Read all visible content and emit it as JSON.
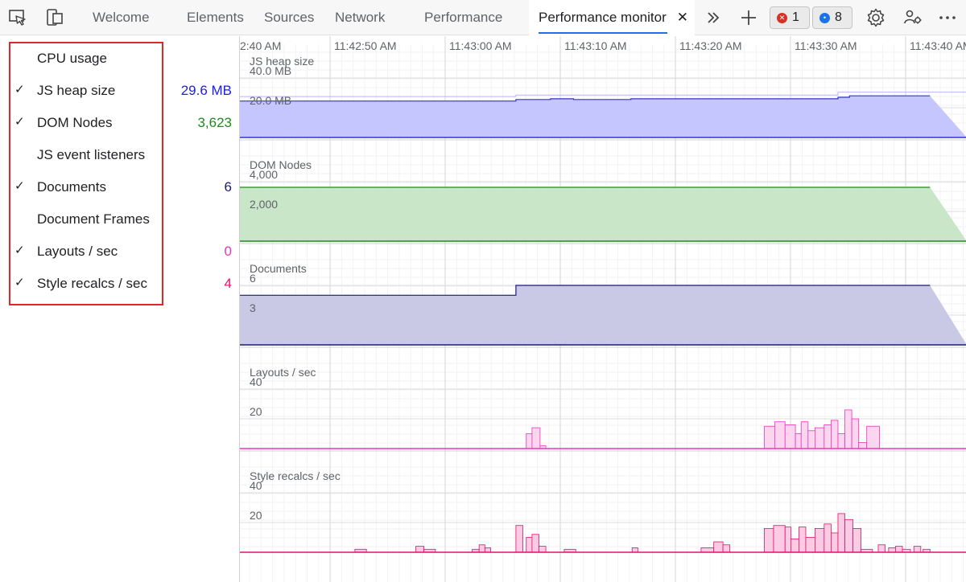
{
  "toolbar": {
    "tabs": [
      {
        "label": "Welcome"
      },
      {
        "label": "Elements"
      },
      {
        "label": "Sources"
      },
      {
        "label": "Network"
      },
      {
        "label": "Performance"
      },
      {
        "label": "Performance monitor",
        "active": true,
        "closable": true
      }
    ],
    "error_count": "1",
    "message_count": "8",
    "colors": {
      "error": "#d93025",
      "message": "#1a73e8",
      "accent": "#1a73e8"
    }
  },
  "metrics": [
    {
      "label": "CPU usage",
      "checked": false,
      "value": "",
      "color": "#000000"
    },
    {
      "label": "JS heap size",
      "checked": true,
      "value": "29.6 MB",
      "color": "#1b1bff"
    },
    {
      "label": "DOM Nodes",
      "checked": true,
      "value": "3,623",
      "color": "#1e8a1e"
    },
    {
      "label": "JS event listeners",
      "checked": false,
      "value": "",
      "color": "#000000"
    },
    {
      "label": "Documents",
      "checked": true,
      "value": "6",
      "color": "#1a1a7a"
    },
    {
      "label": "Document Frames",
      "checked": false,
      "value": "",
      "color": "#000000"
    },
    {
      "label": "Layouts / sec",
      "checked": true,
      "value": "0",
      "color": "#ee33bb"
    },
    {
      "label": "Style recalcs / sec",
      "checked": true,
      "value": "4",
      "color": "#e0106e"
    }
  ],
  "time_axis": {
    "labels": [
      "2:40 AM",
      "11:42:50 AM",
      "11:43:00 AM",
      "11:43:10 AM",
      "11:43:20 AM",
      "11:43:30 AM",
      "11:43:40 AM"
    ]
  },
  "charts": [
    {
      "title": "JS heap size",
      "axis_labels": [
        "40.0 MB",
        "20.0 MB"
      ],
      "ylim": [
        0,
        40
      ],
      "line_color": "#3333cc",
      "fill_color": "#c6c6ff",
      "series": [
        {
          "t0": 0,
          "t1": 24,
          "v": 24.5
        },
        {
          "t0": 24,
          "t1": 27,
          "v": 25.5
        },
        {
          "t0": 27,
          "t1": 29,
          "v": 26
        },
        {
          "t0": 29,
          "t1": 34,
          "v": 25.5
        },
        {
          "t0": 34,
          "t1": 36,
          "v": 26
        },
        {
          "t0": 36,
          "t1": 37,
          "v": 26
        },
        {
          "t0": 37,
          "t1": 52,
          "v": 26
        },
        {
          "t0": 52,
          "t1": 53,
          "v": 27
        },
        {
          "t0": 53,
          "t1": 60,
          "v": 28
        }
      ]
    },
    {
      "title": "DOM Nodes",
      "axis_labels": [
        "4,000",
        "2,000"
      ],
      "ylim": [
        0,
        4000
      ],
      "line_color": "#1e8a1e",
      "fill_color": "#c9e6c9",
      "series": [
        {
          "t0": 0,
          "t1": 60,
          "v": 3623
        }
      ]
    },
    {
      "title": "Documents",
      "axis_labels": [
        "6",
        "3"
      ],
      "ylim": [
        0,
        6
      ],
      "line_color": "#1a1a7a",
      "fill_color": "#c9c9e6",
      "series": [
        {
          "t0": 0,
          "t1": 24,
          "v": 5
        },
        {
          "t0": 24,
          "t1": 60,
          "v": 6
        }
      ]
    },
    {
      "title": "Layouts / sec",
      "axis_labels": [
        "40",
        "20"
      ],
      "ylim": [
        0,
        40
      ],
      "line_color": "#ee33bb",
      "fill_color": "#fcd6ef",
      "series": [
        {
          "t0": 24.9,
          "t1": 25.4,
          "v": 10
        },
        {
          "t0": 25.4,
          "t1": 26.1,
          "v": 14
        },
        {
          "t0": 26.1,
          "t1": 26.6,
          "v": 2
        },
        {
          "t0": 45.6,
          "t1": 46.5,
          "v": 15
        },
        {
          "t0": 46.5,
          "t1": 47.4,
          "v": 18
        },
        {
          "t0": 47.4,
          "t1": 48.3,
          "v": 16
        },
        {
          "t0": 48.3,
          "t1": 48.8,
          "v": 10
        },
        {
          "t0": 48.8,
          "t1": 49.4,
          "v": 18
        },
        {
          "t0": 49.4,
          "t1": 50.0,
          "v": 12
        },
        {
          "t0": 50.0,
          "t1": 50.8,
          "v": 14
        },
        {
          "t0": 50.8,
          "t1": 51.4,
          "v": 16
        },
        {
          "t0": 51.4,
          "t1": 52.0,
          "v": 19
        },
        {
          "t0": 52.0,
          "t1": 52.6,
          "v": 10
        },
        {
          "t0": 52.6,
          "t1": 53.2,
          "v": 26
        },
        {
          "t0": 53.2,
          "t1": 53.8,
          "v": 20
        },
        {
          "t0": 53.8,
          "t1": 54.5,
          "v": 4
        },
        {
          "t0": 54.5,
          "t1": 55.6,
          "v": 15
        }
      ]
    },
    {
      "title": "Style recalcs / sec",
      "axis_labels": [
        "40",
        "20"
      ],
      "ylim": [
        0,
        40
      ],
      "line_color": "#e0106e",
      "fill_color": "#fbcbe3",
      "series": [
        {
          "t0": 10.0,
          "t1": 11.0,
          "v": 2
        },
        {
          "t0": 15.3,
          "t1": 16.0,
          "v": 4
        },
        {
          "t0": 16.0,
          "t1": 17.0,
          "v": 2
        },
        {
          "t0": 20.2,
          "t1": 20.8,
          "v": 2
        },
        {
          "t0": 20.8,
          "t1": 21.3,
          "v": 5
        },
        {
          "t0": 21.3,
          "t1": 21.8,
          "v": 3
        },
        {
          "t0": 24.0,
          "t1": 24.6,
          "v": 18
        },
        {
          "t0": 24.9,
          "t1": 25.4,
          "v": 10
        },
        {
          "t0": 25.4,
          "t1": 26.0,
          "v": 12
        },
        {
          "t0": 26.0,
          "t1": 26.6,
          "v": 4
        },
        {
          "t0": 28.2,
          "t1": 29.2,
          "v": 2
        },
        {
          "t0": 34.1,
          "t1": 34.6,
          "v": 3
        },
        {
          "t0": 40.1,
          "t1": 41.2,
          "v": 3
        },
        {
          "t0": 41.2,
          "t1": 42.0,
          "v": 7
        },
        {
          "t0": 42.0,
          "t1": 42.6,
          "v": 5
        },
        {
          "t0": 45.6,
          "t1": 46.4,
          "v": 16
        },
        {
          "t0": 46.4,
          "t1": 47.4,
          "v": 18
        },
        {
          "t0": 47.4,
          "t1": 47.9,
          "v": 17
        },
        {
          "t0": 47.9,
          "t1": 48.6,
          "v": 9
        },
        {
          "t0": 48.6,
          "t1": 49.2,
          "v": 17
        },
        {
          "t0": 49.2,
          "t1": 50.0,
          "v": 10
        },
        {
          "t0": 50.0,
          "t1": 50.8,
          "v": 16
        },
        {
          "t0": 50.8,
          "t1": 51.4,
          "v": 19
        },
        {
          "t0": 51.4,
          "t1": 52.0,
          "v": 13
        },
        {
          "t0": 52.0,
          "t1": 52.6,
          "v": 26
        },
        {
          "t0": 52.6,
          "t1": 53.3,
          "v": 22
        },
        {
          "t0": 53.3,
          "t1": 54.0,
          "v": 16
        },
        {
          "t0": 54.0,
          "t1": 55.0,
          "v": 2
        },
        {
          "t0": 55.5,
          "t1": 56.1,
          "v": 5
        },
        {
          "t0": 56.4,
          "t1": 57.0,
          "v": 3
        },
        {
          "t0": 57.0,
          "t1": 57.6,
          "v": 4
        },
        {
          "t0": 57.6,
          "t1": 58.3,
          "v": 2
        },
        {
          "t0": 58.6,
          "t1": 59.2,
          "v": 4
        },
        {
          "t0": 59.4,
          "t1": 60.0,
          "v": 2
        }
      ]
    }
  ]
}
